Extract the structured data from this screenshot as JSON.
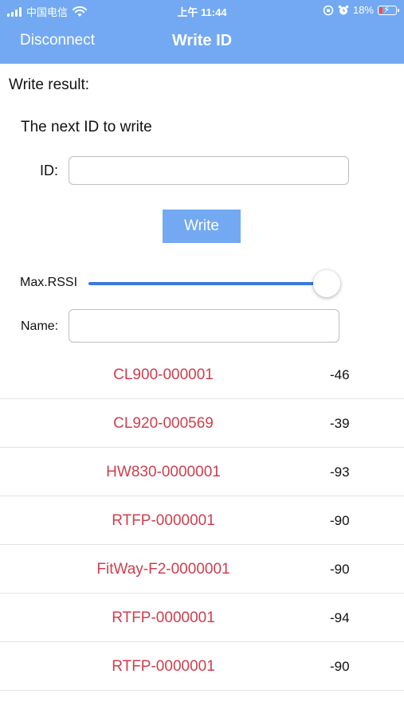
{
  "status_bar": {
    "carrier": "中国电信",
    "time": "上午 11:44",
    "battery": "18%",
    "battery_color": "#ff4b4b"
  },
  "nav": {
    "left_label": "Disconnect",
    "title": "Write ID",
    "color": "#72a9f2"
  },
  "form": {
    "write_result_label": "Write result:",
    "next_id_label": "The next ID to write",
    "id_label": "ID:",
    "id_value": "",
    "write_button_label": "Write",
    "rssi_label": "Max.RSSI",
    "rssi_level_fraction": 0.99,
    "name_label": "Name:",
    "name_value": ""
  },
  "devices": [
    {
      "name": "CL900-000001",
      "rssi": "-46"
    },
    {
      "name": "CL920-000569",
      "rssi": "-39"
    },
    {
      "name": "HW830-0000001",
      "rssi": "-93"
    },
    {
      "name": "RTFP-0000001",
      "rssi": "-90"
    },
    {
      "name": "FitWay-F2-0000001",
      "rssi": "-90"
    },
    {
      "name": "RTFP-0000001",
      "rssi": "-94"
    },
    {
      "name": "RTFP-0000001",
      "rssi": "-90"
    }
  ],
  "colors": {
    "device_name": "#cf3e4d",
    "slider": "#3d7ad8"
  }
}
